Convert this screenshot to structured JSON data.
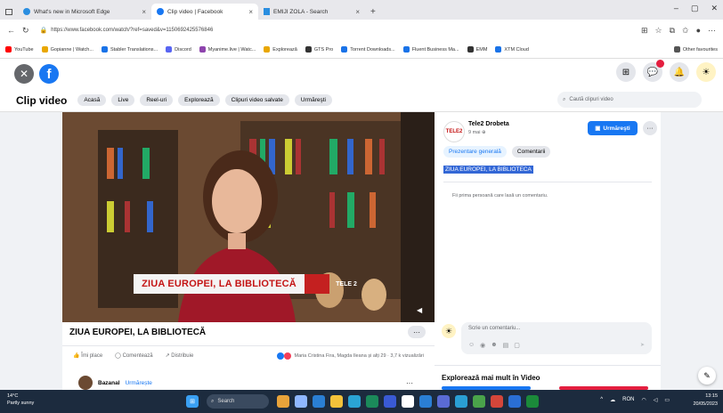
{
  "browser": {
    "tabs": [
      {
        "label": "What's new in Microsoft Edge",
        "active": false
      },
      {
        "label": "Clip video | Facebook",
        "active": true
      },
      {
        "label": "EMIJI ZOLA - Search",
        "active": false
      }
    ],
    "url": "https://www.facebook.com/watch/?ref=saved&v=1150692425576846"
  },
  "bookmarks": [
    {
      "label": "YouTube",
      "color": "#ff0000"
    },
    {
      "label": "Gopianne | Watch...",
      "color": "#e9a700"
    },
    {
      "label": "Stabler Translations...",
      "color": "#1a73e8"
    },
    {
      "label": "Discord",
      "color": "#5865f2"
    },
    {
      "label": "Myanime.live | Watc...",
      "color": "#8e44ad"
    },
    {
      "label": "Explorează",
      "color": "#e9a700"
    },
    {
      "label": "GTS Pro",
      "color": "#333333"
    },
    {
      "label": "Torrent Downloads...",
      "color": "#1a73e8"
    },
    {
      "label": "Fluent Business Ma...",
      "color": "#1a73e8"
    },
    {
      "label": "EMM",
      "color": "#333333"
    },
    {
      "label": "XTM Cloud",
      "color": "#1a73e8"
    },
    {
      "label": "Other favourites",
      "color": "#555555"
    }
  ],
  "facebook": {
    "subnav": {
      "title": "Clip video",
      "pills": [
        "Acasă",
        "Live",
        "Reel-uri",
        "Explorează",
        "Clipuri video salvate",
        "Urmăreşti"
      ]
    },
    "search_placeholder": "Caută clipuri video",
    "video": {
      "caption": "ZIUA EUROPEI, LA BIBLIOTECĂ",
      "logo": "TELE 2",
      "title": "ZIUA EUROPEI, LA BIBLIOTECĂ",
      "actions": [
        "Îmi place",
        "Comentează",
        "Distribuie"
      ],
      "reactions_text": "Maria Cristina Fira, Magda Ileana și alți 29 · 3,7 k vizualizări"
    },
    "next_post": {
      "name": "Bazanal",
      "follow": "Urmărește",
      "more": "···"
    },
    "right": {
      "page_name": "Tele2 Drobeta",
      "time": "9 mai",
      "follow": "Urmăreşti",
      "tabs": [
        "Prezentare generală",
        "Comentarii"
      ],
      "selected_text": "ZIUA EUROPEI, LA BIBLIOTECA",
      "first_comment": "Fii prima persoană care lasă un comentariu.",
      "comment_placeholder": "Scrie un comentariu...",
      "explore": "Explorează mai mult în Video"
    }
  },
  "taskbar": {
    "weather": [
      "14°C",
      "Partly sunny"
    ],
    "search": "Search",
    "clock": [
      "13:15",
      "20/05/2023"
    ],
    "lang": "RON"
  },
  "colors": {
    "fb_blue": "#1877f2",
    "taskbar": "#1c2b3e",
    "caption_red": "#c41414"
  }
}
